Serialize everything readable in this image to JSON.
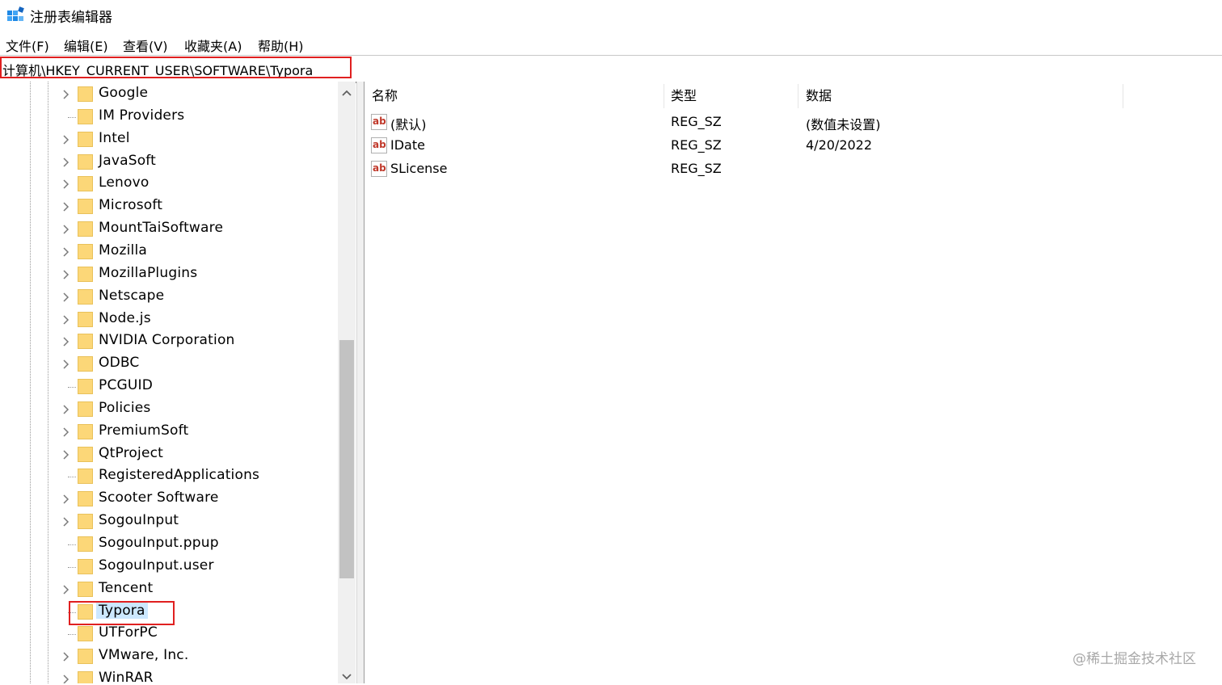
{
  "window": {
    "title": "注册表编辑器"
  },
  "menu": [
    "文件(F)",
    "编辑(E)",
    "查看(V)",
    "收藏夹(A)",
    "帮助(H)"
  ],
  "address": {
    "path": "计算机\\HKEY_CURRENT_USER\\SOFTWARE\\Typora"
  },
  "tree": {
    "items": [
      {
        "label": "Google",
        "expandable": true
      },
      {
        "label": "IM Providers",
        "expandable": false
      },
      {
        "label": "Intel",
        "expandable": true
      },
      {
        "label": "JavaSoft",
        "expandable": true
      },
      {
        "label": "Lenovo",
        "expandable": true
      },
      {
        "label": "Microsoft",
        "expandable": true
      },
      {
        "label": "MountTaiSoftware",
        "expandable": true
      },
      {
        "label": "Mozilla",
        "expandable": true
      },
      {
        "label": "MozillaPlugins",
        "expandable": true
      },
      {
        "label": "Netscape",
        "expandable": true
      },
      {
        "label": "Node.js",
        "expandable": true
      },
      {
        "label": "NVIDIA Corporation",
        "expandable": true
      },
      {
        "label": "ODBC",
        "expandable": true
      },
      {
        "label": "PCGUID",
        "expandable": false
      },
      {
        "label": "Policies",
        "expandable": true
      },
      {
        "label": "PremiumSoft",
        "expandable": true
      },
      {
        "label": "QtProject",
        "expandable": true
      },
      {
        "label": "RegisteredApplications",
        "expandable": false
      },
      {
        "label": "Scooter Software",
        "expandable": true
      },
      {
        "label": "SogouInput",
        "expandable": true
      },
      {
        "label": "SogouInput.ppup",
        "expandable": false
      },
      {
        "label": "SogouInput.user",
        "expandable": false
      },
      {
        "label": "Tencent",
        "expandable": true
      },
      {
        "label": "Typora",
        "expandable": false,
        "selected": true
      },
      {
        "label": "UTForPC",
        "expandable": false
      },
      {
        "label": "VMware, Inc.",
        "expandable": true
      },
      {
        "label": "WinRAR",
        "expandable": true
      }
    ]
  },
  "list": {
    "headers": {
      "name": "名称",
      "type": "类型",
      "data": "数据"
    },
    "rows": [
      {
        "icon": "string-value-icon",
        "badge": "ab",
        "name": "(默认)",
        "type": "REG_SZ",
        "data": "(数值未设置)"
      },
      {
        "icon": "string-value-icon",
        "badge": "ab",
        "name": "IDate",
        "type": "REG_SZ",
        "data": "4/20/2022"
      },
      {
        "icon": "string-value-icon",
        "badge": "ab",
        "name": "SLicense",
        "type": "REG_SZ",
        "data": ""
      }
    ]
  },
  "watermark": "@稀土掘金技术社区",
  "colors": {
    "highlight_border": "#e02020",
    "selection_bg": "#cce8ff",
    "folder": "#fcd778",
    "icon_red": "#c0392b"
  }
}
